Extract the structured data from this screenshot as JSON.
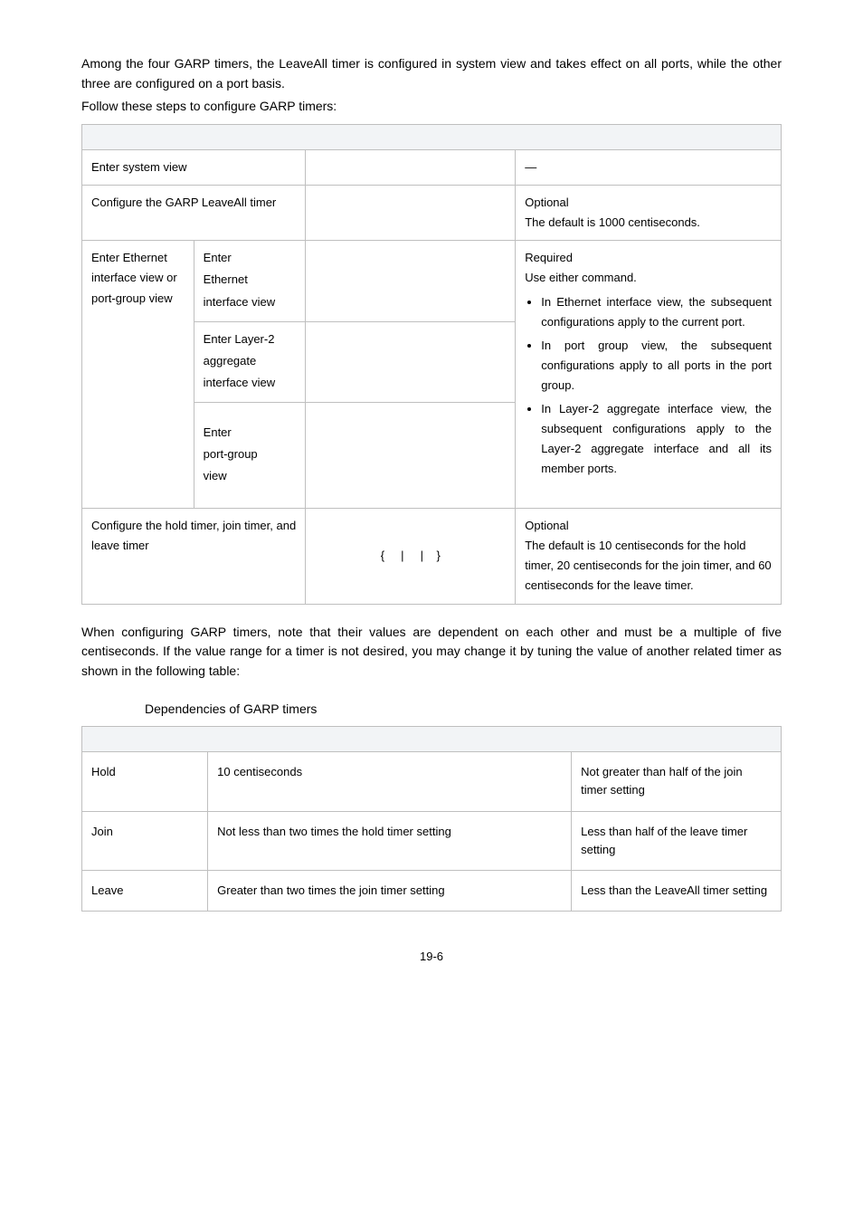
{
  "intro1": "Among the four GARP timers, the LeaveAll timer is configured in system view and takes effect on all ports, while the other three are configured on a port basis.",
  "intro2": "Follow these steps to configure GARP timers:",
  "t1": {
    "r1_todo": "Enter system view",
    "r1_desc": "—",
    "r2_todo": "Configure the GARP LeaveAll timer",
    "r2_d1": "Optional",
    "r2_d2": "The default is 1000 centiseconds.",
    "r3_left": "Enter Ethernet interface view or port-group view",
    "r3a_l1": "Enter",
    "r3a_l2": "Ethernet",
    "r3a_l3": "interface view",
    "r3b_l1": "Enter Layer-2",
    "r3b_l2": "aggregate",
    "r3b_l3": "interface view",
    "r3c_l1": "Enter",
    "r3c_l2": "port-group",
    "r3c_l3": "view",
    "r3_d1": "Required",
    "r3_d2": "Use either command.",
    "r3_b1": "In Ethernet interface view, the subsequent configurations apply to the current port.",
    "r3_b2": "In port group view, the subsequent configurations apply to all ports in the port group.",
    "r3_b3": "In Layer-2 aggregate interface view, the subsequent configurations apply to the Layer-2 aggregate interface and all its member ports.",
    "r4_todo": "Configure the hold timer, join timer, and leave timer",
    "r4_cmd": "{     |     |    }",
    "r4_d1": "Optional",
    "r4_d2": "The default is 10 centiseconds for the hold timer, 20 centiseconds for the join timer, and 60 centiseconds for the leave timer."
  },
  "mid": "When configuring GARP timers, note that their values are dependent on each other and must be a multiple of five centiseconds. If the value range for a timer is not desired, you may change it by tuning the value of another related timer as shown in the following table:",
  "t2_caption": "Dependencies of GARP timers",
  "t2": {
    "r1": {
      "timer": "Hold",
      "lower": "10 centiseconds",
      "upper": "Not greater than half of the join timer setting"
    },
    "r2": {
      "timer": "Join",
      "lower": "Not less than two times the hold timer setting",
      "upper": "Less than half of the leave timer setting"
    },
    "r3": {
      "timer": "Leave",
      "lower": "Greater than two times the join timer setting",
      "upper": "Less than the LeaveAll timer setting"
    }
  },
  "pagenum": "19-6"
}
